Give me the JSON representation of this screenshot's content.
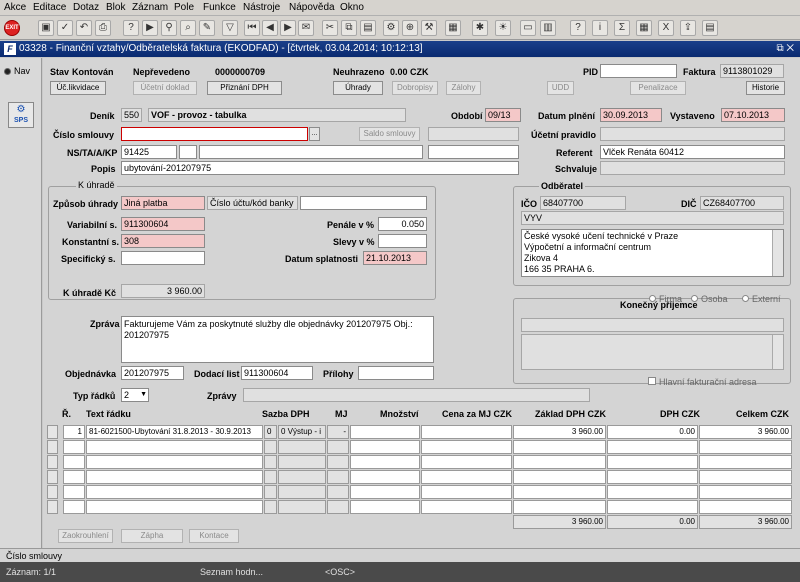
{
  "menu": [
    "Akce",
    "Editace",
    "Dotaz",
    "Blok",
    "Záznam",
    "Pole",
    "Funkce",
    "Nástroje",
    "Nápověda",
    "Okno"
  ],
  "toolbar_icons": [
    "exit-icon",
    "save-icon",
    "commit-icon",
    "rollback-icon",
    "print-icon",
    "query-icon",
    "execute-query-icon",
    "filter-icon",
    "first-record-icon",
    "previous-record-icon",
    "next-record-icon",
    "last-record-icon",
    "new-record-icon",
    "mail-icon",
    "cut-icon",
    "copy-icon",
    "paste-icon",
    "settings-icon",
    "attachment-icon",
    "tools-icon",
    "star-icon",
    "document-icon",
    "help-icon",
    "sum-icon",
    "calculator-icon",
    "excel-icon",
    "export-icon",
    "report-icon"
  ],
  "toolbar_exit_label": "EXIT",
  "window": {
    "icon_text": "F",
    "title": "03328 - Finanční vztahy/Odběratelská faktura (EKODFAD) - [čtvrtek, 03.04.2014; 10:12:13]",
    "controls": "⧉ ✕"
  },
  "sidebar": {
    "nav_label": "Nav",
    "sps_label": "SPS"
  },
  "header": {
    "stav_label": "Stav",
    "stav_value": "Kontován",
    "neprevedeno": "Nepřevedeno",
    "cislo": "0000000709",
    "neuhrazeno_label": "Neuhrazeno",
    "neuhrazeno_value": "0.00 CZK",
    "pid_label": "PID",
    "pid_value": "",
    "faktura_label": "Faktura",
    "faktura_value": "9113801029"
  },
  "buttons": {
    "uc_likvidace": "Úč.likvidace",
    "ucetni_doklad": "Účetní doklad",
    "priznani_dph": "Přiznání DPH",
    "uhrady": "Úhrady",
    "dobropisy": "Dobropisy",
    "zalohy": "Zálohy",
    "udd": "UDD",
    "penalizace": "Penalizace",
    "historie": "Historie",
    "saldo_smlouvy": "Saldo smlouvy",
    "zaokrouhleni": "Zaokrouhlení",
    "zapha": "Zápha",
    "kontace": "Kontace"
  },
  "form": {
    "denik_label": "Deník",
    "denik_code": "550",
    "denik_name": "VOF - provoz - tabulka",
    "obdobi_label": "Období",
    "obdobi_value": "09/13",
    "datum_plneni_label": "Datum plnění",
    "datum_plneni_value": "30.09.2013",
    "vystaveno_label": "Vystaveno",
    "vystaveno_value": "07.10.2013",
    "cislo_smlouvy_label": "Číslo smlouvy",
    "cislo_smlouvy_value": "",
    "ellipsis": "...",
    "ucetni_pravidlo_label": "Účetní pravidlo",
    "ns_label": "NS/TA/A/KP",
    "ns_value": "91425",
    "referent_label": "Referent",
    "referent_value": "Vlček Renáta 60412",
    "popis_label": "Popis",
    "popis_value": "ubytování-201207975",
    "schvaluje_label": "Schvaluje"
  },
  "k_uhrade": {
    "title": "K úhradě",
    "zpusob_label": "Způsob úhrady",
    "zpusob_value": "Jiná platba",
    "cislo_uctu_label": "Číslo účtu/kód banky",
    "variabilni_label": "Variabilní s.",
    "variabilni_value": "911300604",
    "konstantni_label": "Konstantní s.",
    "konstantni_value": "308",
    "specificky_label": "Specifický s.",
    "penale_label": "Penále v %",
    "penale_value": "0.050",
    "slevy_label": "Slevy v %",
    "datum_splatnosti_label": "Datum splatnosti",
    "datum_splatnosti_value": "21.10.2013",
    "k_uhrade_kc_label": "K úhradě Kč",
    "k_uhrade_kc_value": "3 960.00"
  },
  "odberatel": {
    "title": "Odběratel",
    "ico_label": "IČO",
    "ico_value": "68407700",
    "dic_label": "DIČ",
    "dic_value": "CZ68407700",
    "short": "VYV",
    "address": [
      "České vysoké učení technické v Praze",
      "Výpočetní a informační centrum",
      "Zikova 4",
      "166 35 PRAHA 6."
    ]
  },
  "konecny": {
    "title": "Konečný příjemce",
    "firma": "Firma",
    "osoba": "Osoba",
    "externi": "Externí",
    "hlavni": "Hlavní fakturační adresa"
  },
  "zprava": {
    "label": "Zpráva",
    "text": "Fakturujeme Vám za poskytnuté služby dle objednávky 201207975 Obj.: 201207975"
  },
  "objednavka": {
    "label": "Objednávka",
    "value": "201207975",
    "dodaci_label": "Dodací list",
    "dodaci_value": "911300604",
    "prilohy_label": "Přílohy"
  },
  "typ_radku": {
    "label": "Typ řádků",
    "value": "2",
    "zpravy_label": "Zprávy"
  },
  "grid": {
    "headers": [
      "Ř.",
      "Text řádku",
      "Sazba DPH",
      "MJ",
      "Množství",
      "Cena za MJ CZK",
      "Základ DPH CZK",
      "DPH CZK",
      "Celkem CZK"
    ],
    "row": {
      "r": "1",
      "text": "81-6021500-Ubytování 31.8.2013 - 30.9.2013",
      "sazba_code": "0",
      "sazba": "0 Výstup - i",
      "mj": "-",
      "mnozstvi": "",
      "cena": "",
      "zaklad": "3 960.00",
      "dph": "0.00",
      "celkem": "3 960.00"
    },
    "totals": {
      "zaklad": "3 960.00",
      "dph": "0.00",
      "celkem": "3 960.00"
    }
  },
  "status": {
    "hint": "Číslo smlouvy",
    "zaznam": "Záznam: 1/1",
    "seznam": "Seznam hodn...",
    "osc": "<OSC>"
  }
}
